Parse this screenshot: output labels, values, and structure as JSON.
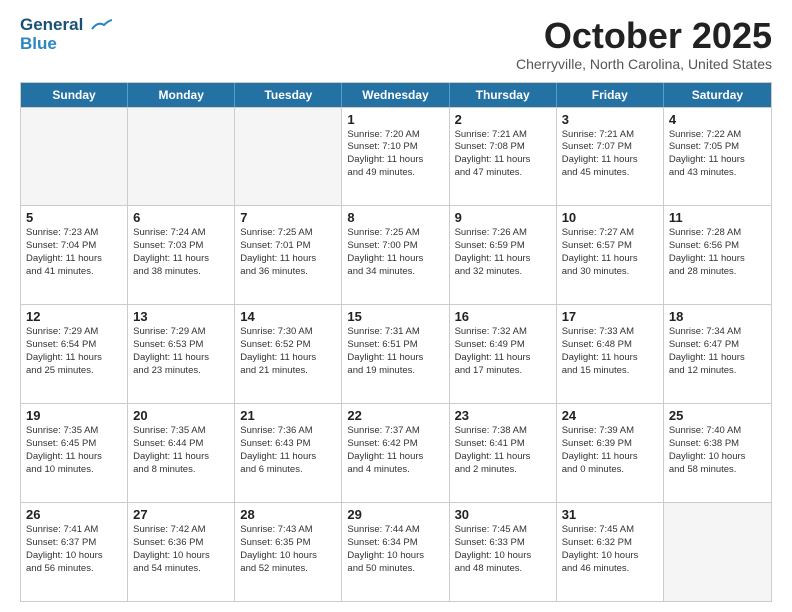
{
  "header": {
    "logo_line1": "General",
    "logo_line2": "Blue",
    "month": "October 2025",
    "location": "Cherryville, North Carolina, United States"
  },
  "weekdays": [
    "Sunday",
    "Monday",
    "Tuesday",
    "Wednesday",
    "Thursday",
    "Friday",
    "Saturday"
  ],
  "weeks": [
    [
      {
        "day": "",
        "info": ""
      },
      {
        "day": "",
        "info": ""
      },
      {
        "day": "",
        "info": ""
      },
      {
        "day": "1",
        "info": "Sunrise: 7:20 AM\nSunset: 7:10 PM\nDaylight: 11 hours\nand 49 minutes."
      },
      {
        "day": "2",
        "info": "Sunrise: 7:21 AM\nSunset: 7:08 PM\nDaylight: 11 hours\nand 47 minutes."
      },
      {
        "day": "3",
        "info": "Sunrise: 7:21 AM\nSunset: 7:07 PM\nDaylight: 11 hours\nand 45 minutes."
      },
      {
        "day": "4",
        "info": "Sunrise: 7:22 AM\nSunset: 7:05 PM\nDaylight: 11 hours\nand 43 minutes."
      }
    ],
    [
      {
        "day": "5",
        "info": "Sunrise: 7:23 AM\nSunset: 7:04 PM\nDaylight: 11 hours\nand 41 minutes."
      },
      {
        "day": "6",
        "info": "Sunrise: 7:24 AM\nSunset: 7:03 PM\nDaylight: 11 hours\nand 38 minutes."
      },
      {
        "day": "7",
        "info": "Sunrise: 7:25 AM\nSunset: 7:01 PM\nDaylight: 11 hours\nand 36 minutes."
      },
      {
        "day": "8",
        "info": "Sunrise: 7:25 AM\nSunset: 7:00 PM\nDaylight: 11 hours\nand 34 minutes."
      },
      {
        "day": "9",
        "info": "Sunrise: 7:26 AM\nSunset: 6:59 PM\nDaylight: 11 hours\nand 32 minutes."
      },
      {
        "day": "10",
        "info": "Sunrise: 7:27 AM\nSunset: 6:57 PM\nDaylight: 11 hours\nand 30 minutes."
      },
      {
        "day": "11",
        "info": "Sunrise: 7:28 AM\nSunset: 6:56 PM\nDaylight: 11 hours\nand 28 minutes."
      }
    ],
    [
      {
        "day": "12",
        "info": "Sunrise: 7:29 AM\nSunset: 6:54 PM\nDaylight: 11 hours\nand 25 minutes."
      },
      {
        "day": "13",
        "info": "Sunrise: 7:29 AM\nSunset: 6:53 PM\nDaylight: 11 hours\nand 23 minutes."
      },
      {
        "day": "14",
        "info": "Sunrise: 7:30 AM\nSunset: 6:52 PM\nDaylight: 11 hours\nand 21 minutes."
      },
      {
        "day": "15",
        "info": "Sunrise: 7:31 AM\nSunset: 6:51 PM\nDaylight: 11 hours\nand 19 minutes."
      },
      {
        "day": "16",
        "info": "Sunrise: 7:32 AM\nSunset: 6:49 PM\nDaylight: 11 hours\nand 17 minutes."
      },
      {
        "day": "17",
        "info": "Sunrise: 7:33 AM\nSunset: 6:48 PM\nDaylight: 11 hours\nand 15 minutes."
      },
      {
        "day": "18",
        "info": "Sunrise: 7:34 AM\nSunset: 6:47 PM\nDaylight: 11 hours\nand 12 minutes."
      }
    ],
    [
      {
        "day": "19",
        "info": "Sunrise: 7:35 AM\nSunset: 6:45 PM\nDaylight: 11 hours\nand 10 minutes."
      },
      {
        "day": "20",
        "info": "Sunrise: 7:35 AM\nSunset: 6:44 PM\nDaylight: 11 hours\nand 8 minutes."
      },
      {
        "day": "21",
        "info": "Sunrise: 7:36 AM\nSunset: 6:43 PM\nDaylight: 11 hours\nand 6 minutes."
      },
      {
        "day": "22",
        "info": "Sunrise: 7:37 AM\nSunset: 6:42 PM\nDaylight: 11 hours\nand 4 minutes."
      },
      {
        "day": "23",
        "info": "Sunrise: 7:38 AM\nSunset: 6:41 PM\nDaylight: 11 hours\nand 2 minutes."
      },
      {
        "day": "24",
        "info": "Sunrise: 7:39 AM\nSunset: 6:39 PM\nDaylight: 11 hours\nand 0 minutes."
      },
      {
        "day": "25",
        "info": "Sunrise: 7:40 AM\nSunset: 6:38 PM\nDaylight: 10 hours\nand 58 minutes."
      }
    ],
    [
      {
        "day": "26",
        "info": "Sunrise: 7:41 AM\nSunset: 6:37 PM\nDaylight: 10 hours\nand 56 minutes."
      },
      {
        "day": "27",
        "info": "Sunrise: 7:42 AM\nSunset: 6:36 PM\nDaylight: 10 hours\nand 54 minutes."
      },
      {
        "day": "28",
        "info": "Sunrise: 7:43 AM\nSunset: 6:35 PM\nDaylight: 10 hours\nand 52 minutes."
      },
      {
        "day": "29",
        "info": "Sunrise: 7:44 AM\nSunset: 6:34 PM\nDaylight: 10 hours\nand 50 minutes."
      },
      {
        "day": "30",
        "info": "Sunrise: 7:45 AM\nSunset: 6:33 PM\nDaylight: 10 hours\nand 48 minutes."
      },
      {
        "day": "31",
        "info": "Sunrise: 7:45 AM\nSunset: 6:32 PM\nDaylight: 10 hours\nand 46 minutes."
      },
      {
        "day": "",
        "info": ""
      }
    ]
  ]
}
